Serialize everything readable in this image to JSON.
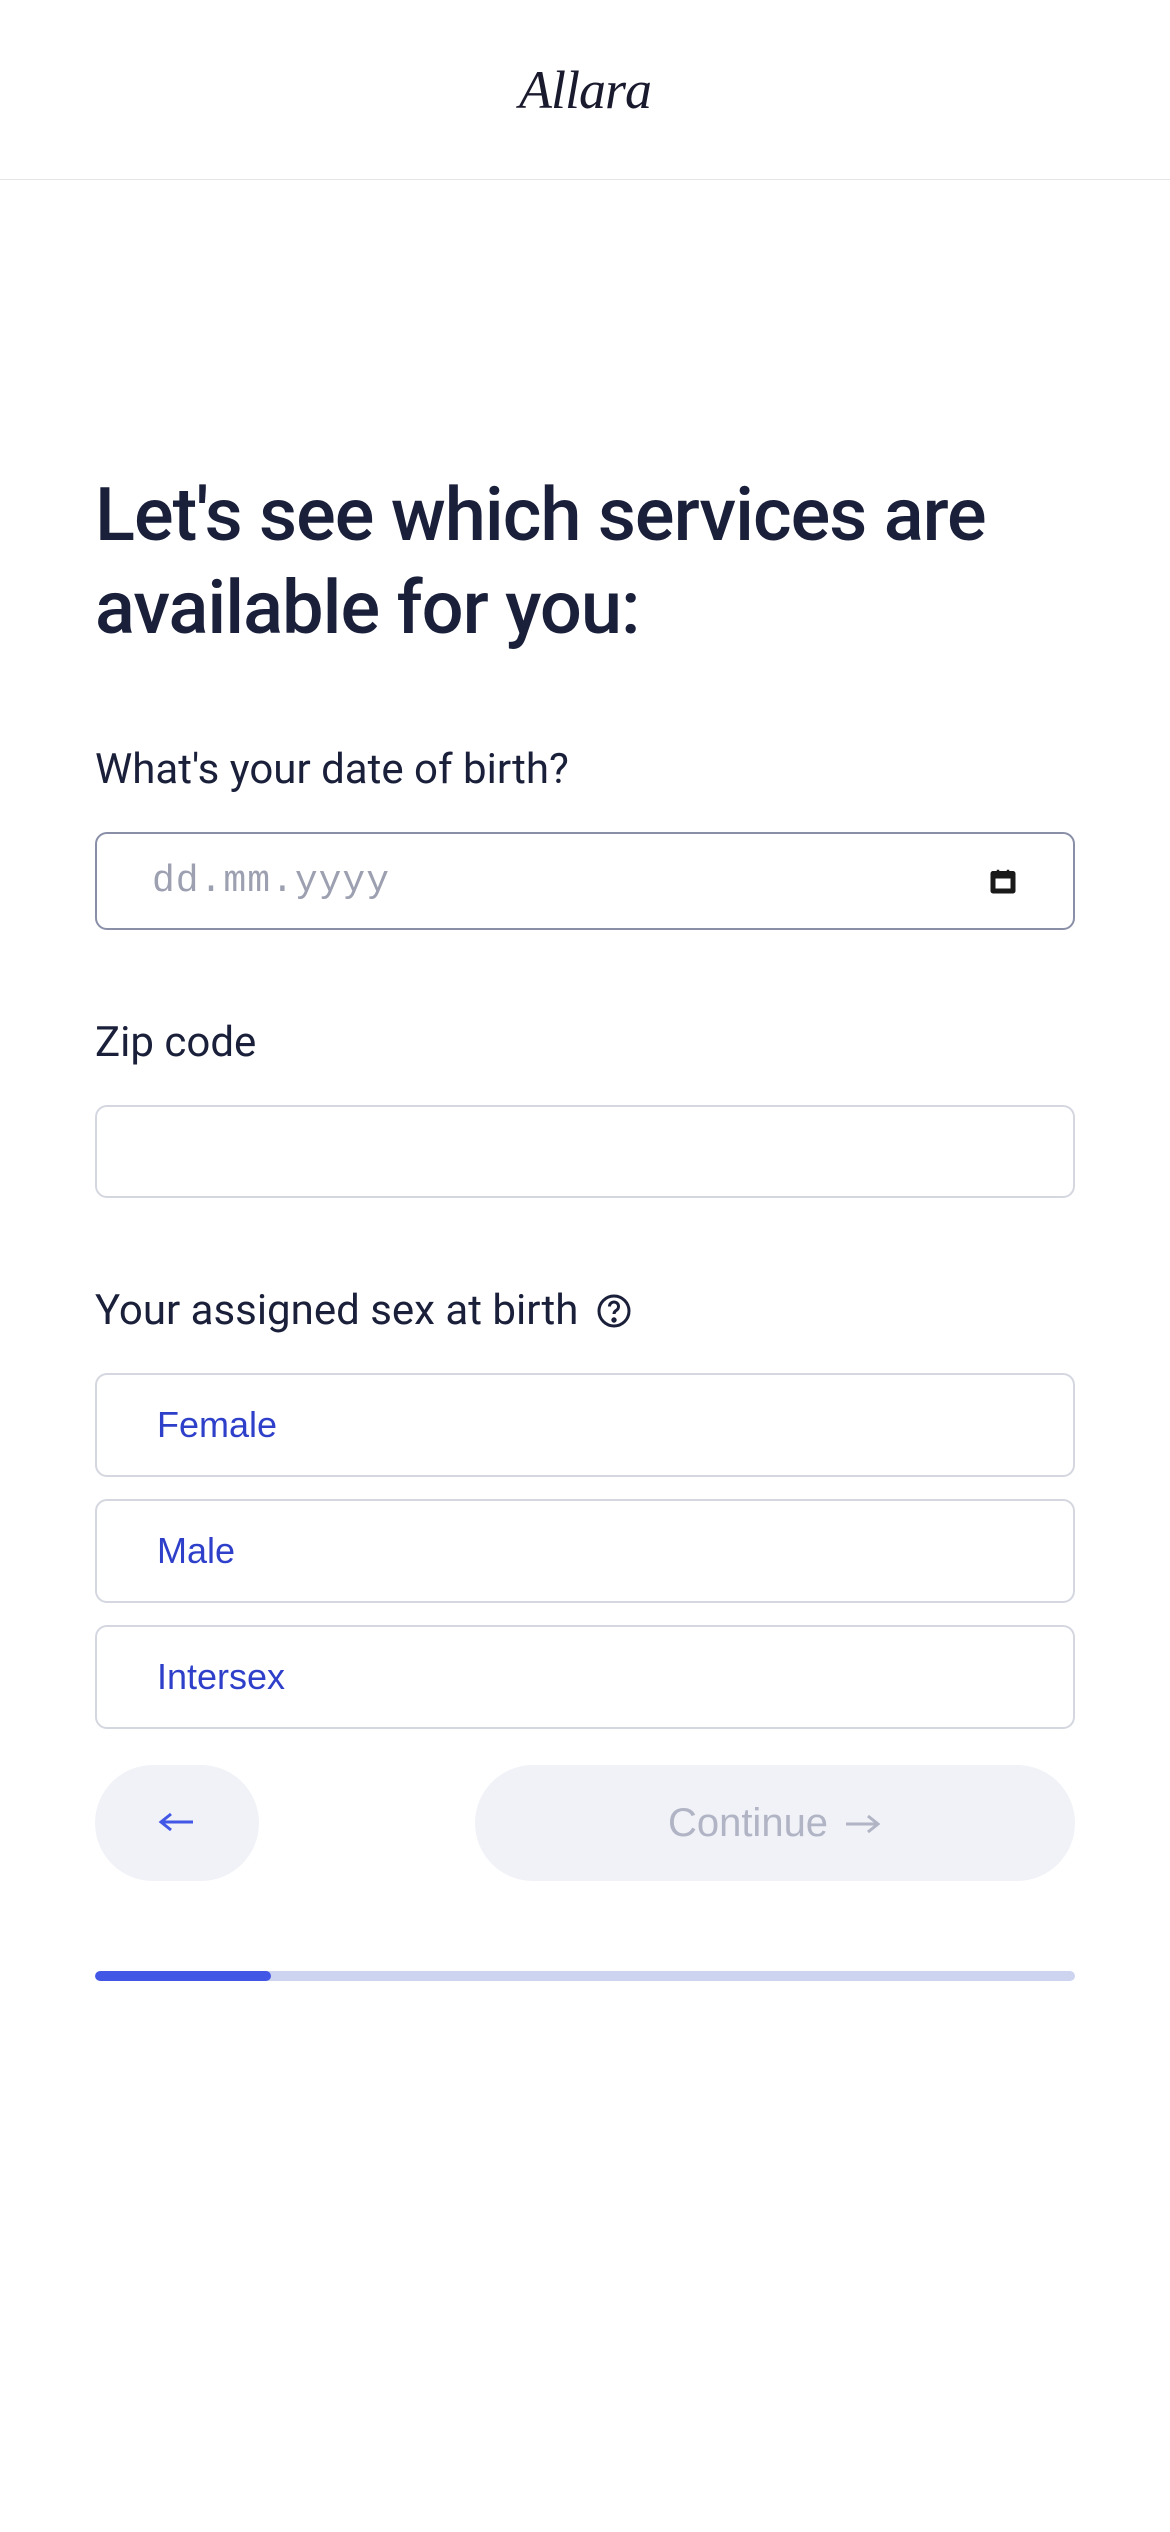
{
  "header": {
    "logo": "Allara"
  },
  "heading": "Let's see which services are available for you:",
  "dob": {
    "label": "What's your date of birth?",
    "placeholder": "dd.mm.yyyy"
  },
  "zip": {
    "label": "Zip code",
    "value": ""
  },
  "sex": {
    "label": "Your assigned sex at birth",
    "options": [
      "Female",
      "Male",
      "Intersex"
    ]
  },
  "nav": {
    "continue_label": "Continue"
  },
  "progress": {
    "percent": 18
  }
}
